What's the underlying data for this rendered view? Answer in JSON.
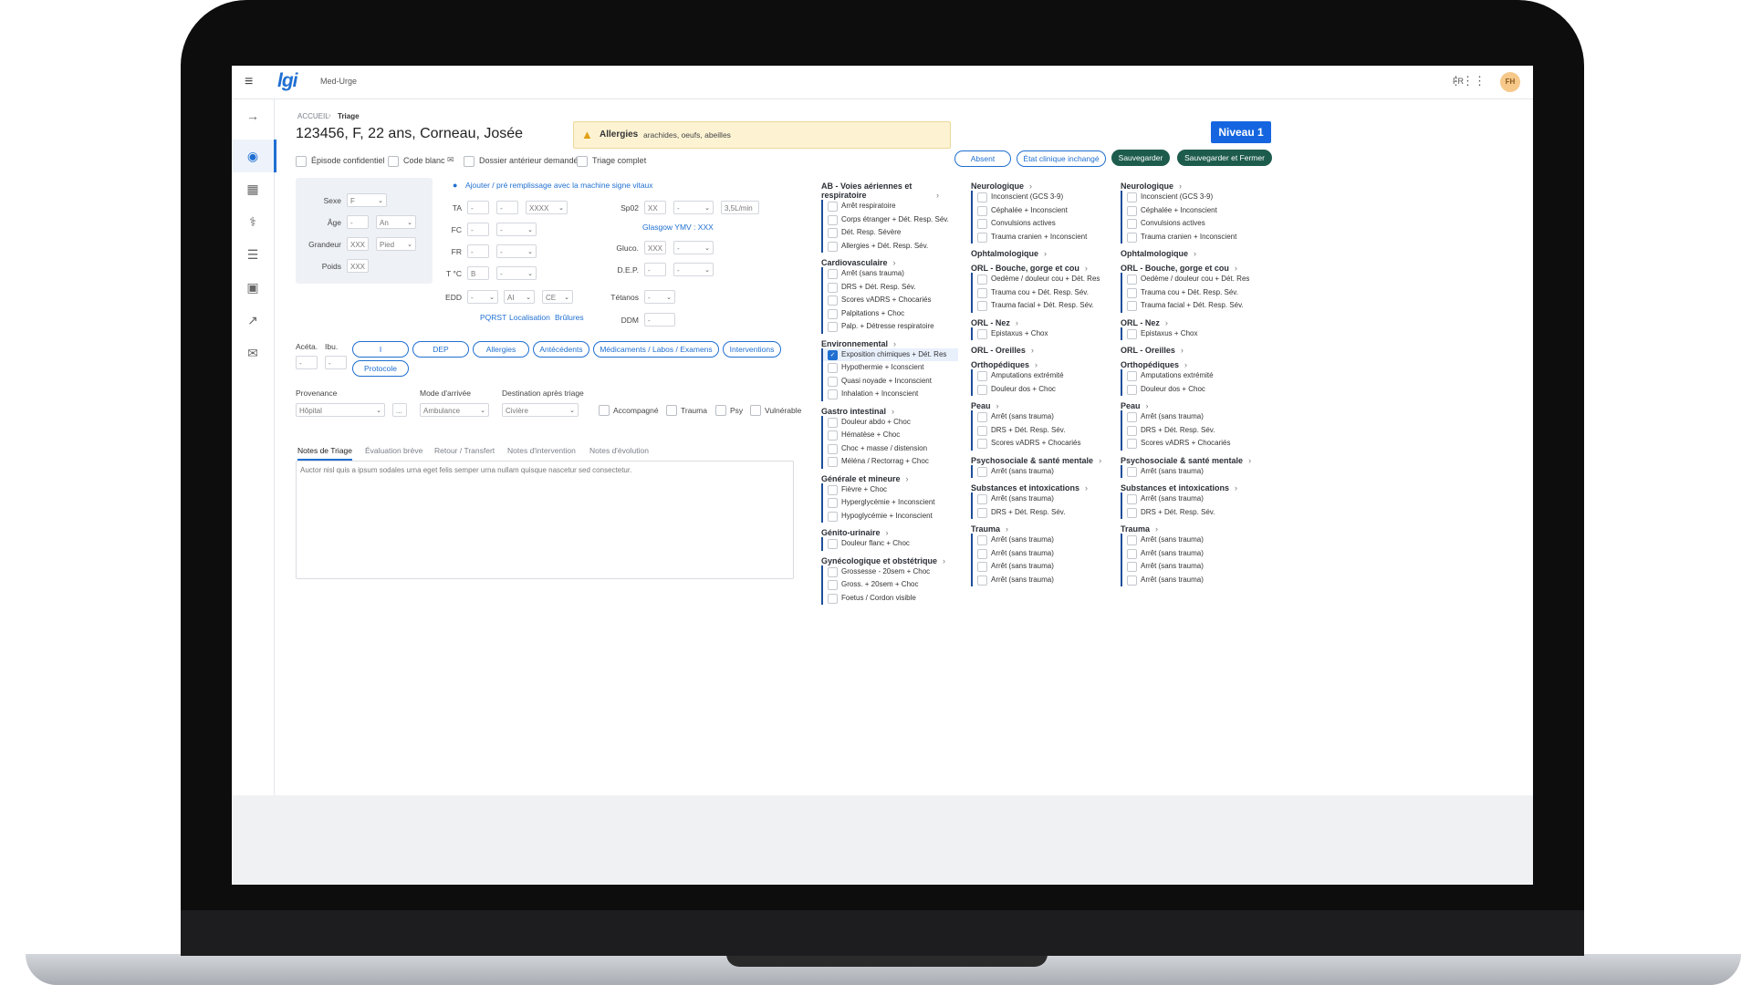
{
  "topbar": {
    "menu_icon": "≡",
    "logo": "lgi",
    "app_name": "Med-Urge",
    "lang": "FR",
    "avatar": "FH"
  },
  "breadcrumb": {
    "home": "ACCUEIL",
    "current": "Triage"
  },
  "patient": {
    "title": "123456, F, 22 ans, Corneau, Josée"
  },
  "allergy": {
    "label": "Allergies",
    "values": "arachides, oeufs, abeilles"
  },
  "level_button": "Niveau 1",
  "actions": {
    "absent": "Absent",
    "etat": "État clinique inchangé",
    "save": "Sauvegarder",
    "save_close": "Sauvegarder et Fermer"
  },
  "flags": {
    "confidential": "Épisode confidentiel",
    "code_blanc": "Code blanc",
    "dossier": "Dossier antérieur demandé",
    "triage_complet": "Triage complet"
  },
  "demographics": {
    "sexe_label": "Sexe",
    "sexe_value": "F",
    "age_label": "Âge",
    "age_value": "-",
    "age_unit": "An",
    "height_label": "Grandeur",
    "height_value": "XXX",
    "height_unit": "Pied",
    "weight_label": "Poids",
    "weight_value": "XXX"
  },
  "vitals": {
    "prefill_link": "Ajouter / pré remplissage avec la machine signe vitaux",
    "ta": "TA",
    "ta1": "-",
    "ta2": "-",
    "ta_sel": "XXXX",
    "fc": "FC",
    "fc1": "-",
    "fc_sel": "-",
    "fr": "FR",
    "fr1": "-",
    "fr_sel": "-",
    "tc": "T °C",
    "tc1": "B",
    "tc_sel": "-",
    "edd": "EDD",
    "edd1": "-",
    "edd2": "AI",
    "edd3": "CE",
    "spo2": "Sp02",
    "spo2_val": "XX",
    "spo2_sel": "-",
    "spo2_rate": "3,5L/min",
    "glasgow": "Glasgow YMV : XXX",
    "gluco": "Gluco.",
    "gluco_val": "XXX",
    "gluco_sel": "-",
    "dep": "D.E.P.",
    "dep_val": "-",
    "dep_sel": "-",
    "tetanos": "Tétanos",
    "tetanos_sel": "-",
    "ddm": "DDM",
    "ddm_val": "-",
    "links": [
      "PQRST",
      "Localisation",
      "Brûlures"
    ]
  },
  "meds": {
    "aceta": "Acéta.",
    "ibu": "Ibu.",
    "aceta_val": "-",
    "ibu_val": "-"
  },
  "pills": [
    "I",
    "DEP",
    "Allergies",
    "Antécédents",
    "Médicaments / Labos / Examens",
    "Interventions"
  ],
  "protocol": "Protocole",
  "arrival": {
    "provenance_label": "Provenance",
    "provenance_value": "Hôpital",
    "more": "...",
    "mode_label": "Mode d'arrivée",
    "mode_value": "Ambulance",
    "dest_label": "Destination après triage",
    "dest_value": "Civière",
    "accompagne": "Accompagné",
    "trauma": "Trauma",
    "psy": "Psy",
    "vulnerable": "Vulnérable"
  },
  "tabs": [
    "Notes de Triage",
    "Évaluation brève",
    "Retour / Transfert",
    "Notes d'intervention",
    "Notes d'évolution"
  ],
  "notes_text": "Auctor nisl quis a ipsum sodales urna eget felis semper urna nullam quisque nascetur sed consectetur.",
  "col1": [
    {
      "title": "AB - Voies aériennes et respiratoire",
      "items": [
        "Arrêt respiratoire",
        "Corps étranger + Dét. Resp. Sév.",
        "Dét. Resp. Sévère",
        "Allergies + Dét. Resp. Sév."
      ]
    },
    {
      "title": "Cardiovasculaire",
      "items": [
        "Arrêt (sans trauma)",
        "DRS + Dét. Resp. Sév.",
        "Scores vADRS + Chocariés",
        "Palpitations + Choc",
        "Palp. + Détresse respiratoire"
      ]
    },
    {
      "title": "Environnemental",
      "items": [
        "Exposition chimiques + Dét. Res",
        "Hypothermie + Iconscient",
        "Quasi noyade + Inconscient",
        "Inhalation + Inconscient"
      ]
    },
    {
      "title": "Gastro intestinal",
      "items": [
        "Douleur abdo + Choc",
        "Hématèse + Choc",
        "Choc + masse / distension",
        "Méléna / Rectorrag + Choc"
      ]
    },
    {
      "title": "Générale et mineure",
      "items": [
        "Fièvre + Choc",
        "Hyperglycémie + Inconscient",
        "Hypoglycémie + Inconscient"
      ]
    },
    {
      "title": "Génito-urinaire",
      "items": [
        "Douleur flanc + Choc"
      ]
    },
    {
      "title": "Gynécologique et obstétrique",
      "items": [
        "Grossesse - 20sem + Choc",
        "Gross. + 20sem + Choc",
        "Foetus / Cordon visible"
      ]
    }
  ],
  "col2": [
    {
      "title": "Neurologique",
      "items": [
        "Inconscient (GCS 3-9)",
        "Céphalée + Inconscient",
        "Convulsions actives",
        "Trauma cranien + Inconscient"
      ]
    },
    {
      "title": "Ophtalmologique",
      "items": []
    },
    {
      "title": "ORL - Bouche, gorge et cou",
      "items": [
        "Oedème / douleur cou + Dét. Res",
        "Trauma cou + Dét. Resp. Sév.",
        "Trauma facial + Dét. Resp. Sév."
      ]
    },
    {
      "title": "ORL - Nez",
      "items": [
        "Epistaxus + Chox"
      ]
    },
    {
      "title": "ORL - Oreilles",
      "items": []
    },
    {
      "title": "Orthopédiques",
      "items": [
        "Amputations extrémité",
        "Douleur dos + Choc"
      ]
    },
    {
      "title": "Peau",
      "items": [
        "Arrêt (sans trauma)",
        "DRS + Dét. Resp. Sév.",
        "Scores vADRS + Chocariés"
      ]
    },
    {
      "title": "Psychosociale & santé mentale",
      "items": [
        "Arrêt (sans trauma)"
      ]
    },
    {
      "title": "Substances et intoxications",
      "items": [
        "Arrêt (sans trauma)",
        "DRS + Dét. Resp. Sév."
      ]
    },
    {
      "title": "Trauma",
      "items": [
        "Arrêt (sans trauma)",
        "Arrêt (sans trauma)",
        "Arrêt (sans trauma)",
        "Arrêt (sans trauma)"
      ]
    }
  ],
  "colors": {
    "accent": "#1f6fd1",
    "dark_button": "#1d5c4c",
    "level_button": "#1565e0",
    "allergy_bg": "#fdf3d3"
  }
}
